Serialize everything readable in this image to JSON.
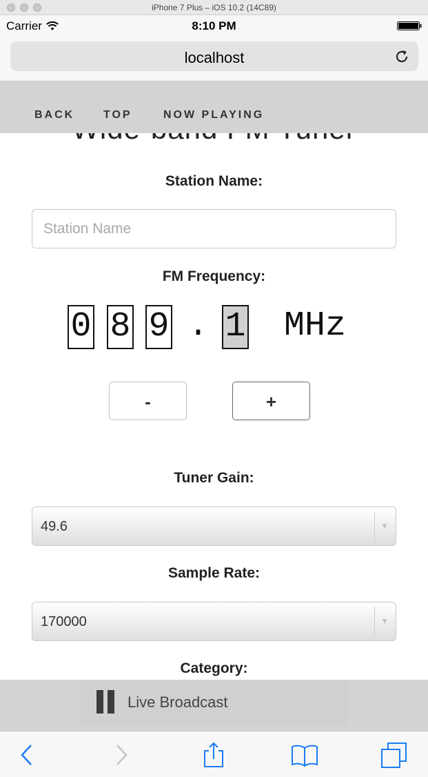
{
  "simulator": {
    "title": "iPhone 7 Plus – iOS 10.2 (14C89)"
  },
  "status_bar": {
    "carrier": "Carrier",
    "time": "8:10 PM",
    "wifi_icon": "wifi-icon",
    "battery_icon": "battery-icon"
  },
  "browser": {
    "url": "localhost",
    "reload_icon": "reload-icon"
  },
  "site_nav": {
    "items": [
      "BACK",
      "TOP",
      "NOW PLAYING"
    ]
  },
  "page": {
    "heading": "Wide-band FM Tuner",
    "station_name_label": "Station Name:",
    "station_name_placeholder": "Station Name",
    "station_name_value": "",
    "fm_frequency_label": "FM Frequency:",
    "frequency_digits": [
      "0",
      "8",
      "9",
      "1"
    ],
    "frequency_separator": ".",
    "frequency_selected_digit": 3,
    "frequency_unit": "MHz",
    "decrement_label": "-",
    "increment_label": "+",
    "tuner_gain_label": "Tuner Gain:",
    "tuner_gain_value": "49.6",
    "sample_rate_label": "Sample Rate:",
    "sample_rate_value": "170000",
    "category_label": "Category:"
  },
  "player": {
    "icon": "pause-icon",
    "label": "Live Broadcast"
  },
  "toolbar": {
    "icons": [
      "back-icon",
      "forward-icon",
      "share-icon",
      "bookmarks-icon",
      "tabs-icon"
    ]
  },
  "colors": {
    "nav_bg": "#d3d3d3",
    "ios_blue": "#1a7cf5",
    "selected_digit_bg": "#d0d0d0"
  }
}
